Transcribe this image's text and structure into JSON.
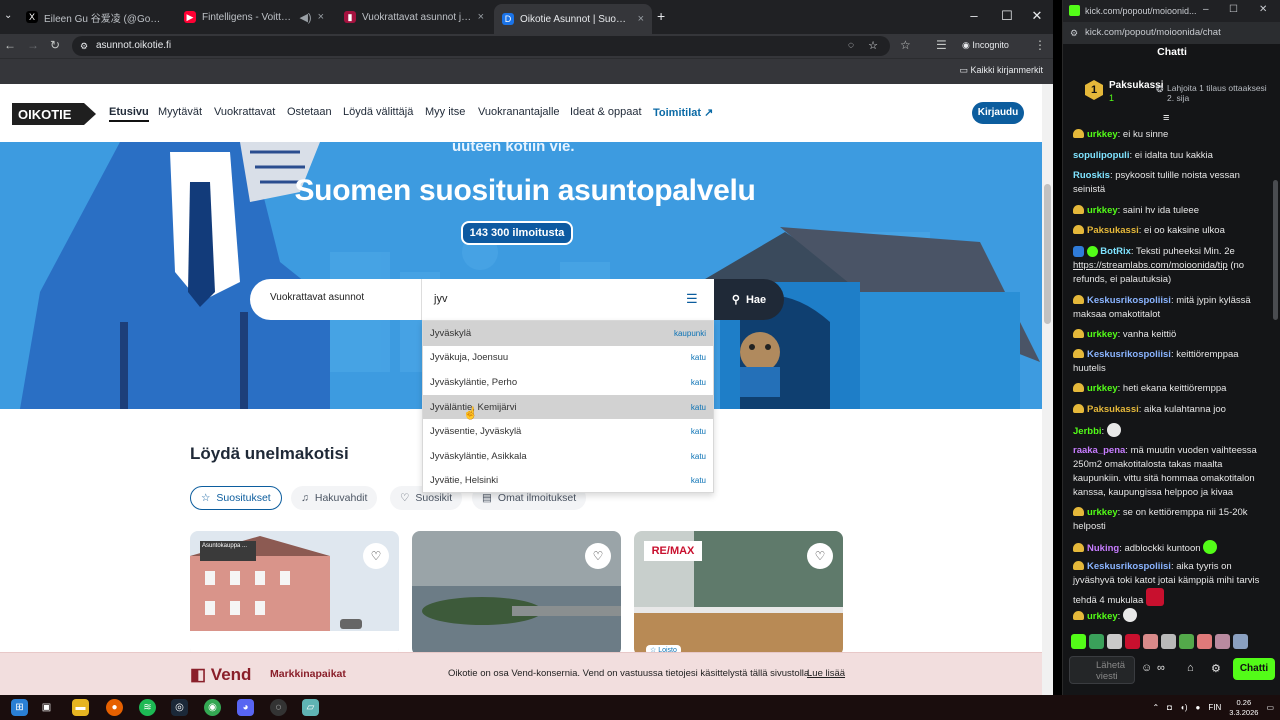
{
  "browser": {
    "tabs": [
      {
        "title": "Eileen Gu 谷爱凌 (@GoEileenGu",
        "favicon": "X"
      },
      {
        "title": "Fintelligens - Voittamaton",
        "favicon": "▶"
      },
      {
        "title": "Vuokrattavat asunnot ja asunto",
        "favicon": "▮"
      },
      {
        "title": "Oikotie Asunnot | Suomen suos",
        "favicon": "D"
      }
    ],
    "new_tab": "+",
    "address": "asunnot.oikotie.fi",
    "profile": "Incognito",
    "bookmarks_label": "Kaikki kirjanmerkit"
  },
  "site": {
    "logo": "OIKOTIE",
    "nav": [
      "Etusivu",
      "Myytävät",
      "Vuokrattavat",
      "Ostetaan",
      "Löydä välittäjä",
      "Myy itse",
      "Vuokranantajalle",
      "Ideat & oppaat",
      "Toimitilat"
    ],
    "login": "Kirjaudu",
    "hero_sub": "uuteen kotiin vie.",
    "hero_title": "Suomen suosituin asuntopalvelu",
    "listing_count": "143 300 ilmoitusta",
    "search": {
      "type": "Vuokrattavat asunnot",
      "query": "jyv",
      "button": "Hae",
      "suggestions": [
        {
          "name": "Jyväskylä",
          "kind": "kaupunki"
        },
        {
          "name": "Jyväkuja, Joensuu",
          "kind": "katu"
        },
        {
          "name": "Jyväskyläntie, Perho",
          "kind": "katu"
        },
        {
          "name": "Jyväläntie, Kemijärvi",
          "kind": "katu"
        },
        {
          "name": "Jyväsentie, Jyväskylä",
          "kind": "katu"
        },
        {
          "name": "Jyväskyläntie, Asikkala",
          "kind": "katu"
        },
        {
          "name": "Jyvätie, Helsinki",
          "kind": "katu"
        }
      ]
    },
    "section_title": "Löydä unelmakotisi",
    "chips": [
      "Suositukset",
      "Hakuvahdit",
      "Suosikit",
      "Omat ilmoitukset"
    ],
    "card1_badge": "Asuntokauppa ...",
    "card3_badge": "RE/MAX",
    "card3_tag": "☆ Loisto",
    "cookie": {
      "brand": "Vend",
      "brand_sub": "Markkinapaikat",
      "text": "Oikotie on osa Vend-konsernia. Vend on vastuussa tietojesi käsittelystä tällä sivustolla.",
      "link": "Lue lisää"
    }
  },
  "taskbar": {
    "lang": "FIN",
    "time": "0.26",
    "date": "3.3.2026"
  },
  "kick": {
    "window_title": "kick.com/popout/moioonid...",
    "url": "kick.com/popout/moioonida/chat",
    "chat_title": "Chatti",
    "sub_leader": {
      "rank": "1",
      "name": "Paksukassi",
      "count": "1"
    },
    "sub_promo": "Lahjoita 1 tilaus ottaaksesi 2. sija",
    "messages": [
      {
        "user": "urkkey",
        "color": "#53fc18",
        "text": "ei ku sinne"
      },
      {
        "user": "sopulipopuli",
        "color": "#7fe3ff",
        "text": "ei idalta tuu kakkia"
      },
      {
        "user": "Ruoskis",
        "color": "#7fe3ff",
        "text": "psykoosit tulille noista vessan seinistä"
      },
      {
        "user": "urkkey",
        "color": "#53fc18",
        "text": "saini hv ida tuleee"
      },
      {
        "user": "Paksukassi",
        "color": "#e5b83a",
        "text": "ei oo kaksine ulkoa"
      },
      {
        "user": "BotRix",
        "color": "#7fe3ff",
        "text": "Teksti puheeksi Min. 2e",
        "link": "https://streamlabs.com/moioonida/tip",
        "text2": " (no refunds, ei palautuksia)"
      },
      {
        "user": "Keskusrikospoliisi",
        "color": "#8ab4ff",
        "text": "mitä jypin kylässä maksaa omakotitalot"
      },
      {
        "user": "urkkey",
        "color": "#53fc18",
        "text": "vanha keittiö"
      },
      {
        "user": "Keskusrikospoliisi",
        "color": "#8ab4ff",
        "text": "keittiöremppaa huutelis"
      },
      {
        "user": "urkkey",
        "color": "#53fc18",
        "text": "heti ekana keittiöremppa"
      },
      {
        "user": "Paksukassi",
        "color": "#e5b83a",
        "text": "aika kulahtanna joo"
      },
      {
        "user": "Jerbbi",
        "color": "#53fc18",
        "text": ""
      },
      {
        "user": "raaka_pena",
        "color": "#c77dff",
        "text": "mä muutin vuoden vaihteessa 250m2 omakotitalosta takas maalta kaupunkiin. vittu sitä hommaa omakotitalon kanssa, kaupungissa helppoo ja kivaa"
      },
      {
        "user": "urkkey",
        "color": "#53fc18",
        "text": "se on kettiöremppa nii 15-20k helposti"
      },
      {
        "user": "Nuking",
        "color": "#c77dff",
        "text": "adblockki kuntoon"
      },
      {
        "user": "Keskusrikospoliisi",
        "color": "#8ab4ff",
        "text": "aika tyyris on jyväshyvä toki katot jotai kämppiä mihi tarvis tehdä 4 mukulaa"
      },
      {
        "user": "urkkey",
        "color": "#53fc18",
        "text": ""
      }
    ],
    "input_placeholder": "Lähetä viesti",
    "send_button": "Chatti"
  }
}
